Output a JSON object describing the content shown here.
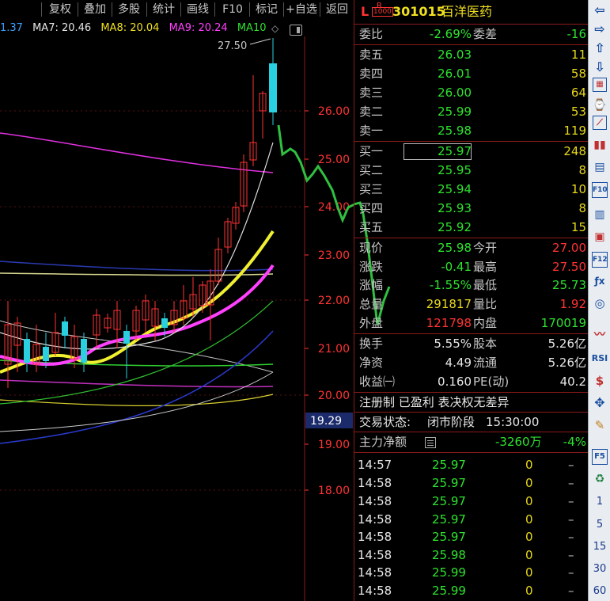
{
  "toolbar": {
    "items": [
      "复权",
      "叠加",
      "多股",
      "统计",
      "画线",
      "F10",
      "标记",
      "+自选",
      "返回"
    ]
  },
  "ma_bar": [
    {
      "label": "1.37",
      "color": "#3aa0ff"
    },
    {
      "label": "MA7: 20.46",
      "color": "#e6e6e6"
    },
    {
      "label": "MA8: 20.04",
      "color": "#f0e020"
    },
    {
      "label": "MA9: 20.24",
      "color": "#ff40ff"
    },
    {
      "label": "MA10",
      "color": "#30e030"
    }
  ],
  "chart": {
    "high_label": "27.50",
    "price_ticks": [
      "26.00",
      "25.00",
      "24.00",
      "23.00",
      "22.00",
      "21.00",
      "20.00",
      "19.00",
      "18.00"
    ],
    "current_marker": "19.29"
  },
  "stock": {
    "flag_L": "L",
    "flag_R": "R",
    "flag_num": "1000",
    "code": "301015",
    "name": "百洋医药"
  },
  "weibi": {
    "label": "委比",
    "value": "-2.69%",
    "label2": "委差",
    "value2": "-16"
  },
  "asks": [
    {
      "label": "卖五",
      "price": "26.03",
      "vol": "11"
    },
    {
      "label": "卖四",
      "price": "26.01",
      "vol": "58"
    },
    {
      "label": "卖三",
      "price": "26.00",
      "vol": "64"
    },
    {
      "label": "卖二",
      "price": "25.99",
      "vol": "53"
    },
    {
      "label": "卖一",
      "price": "25.98",
      "vol": "119"
    }
  ],
  "bids": [
    {
      "label": "买一",
      "price": "25.97",
      "vol": "248"
    },
    {
      "label": "买二",
      "price": "25.95",
      "vol": "8"
    },
    {
      "label": "买三",
      "price": "25.94",
      "vol": "10"
    },
    {
      "label": "买四",
      "price": "25.93",
      "vol": "8"
    },
    {
      "label": "买五",
      "price": "25.92",
      "vol": "15"
    }
  ],
  "quote": [
    {
      "l1": "现价",
      "v1": "25.98",
      "c1": "green",
      "l2": "今开",
      "v2": "27.00",
      "c2": "red"
    },
    {
      "l1": "涨跌",
      "v1": "-0.41",
      "c1": "green",
      "l2": "最高",
      "v2": "27.50",
      "c2": "red"
    },
    {
      "l1": "涨幅",
      "v1": "-1.55%",
      "c1": "green",
      "l2": "最低",
      "v2": "25.73",
      "c2": "green"
    },
    {
      "l1": "总量",
      "v1": "291817",
      "c1": "yellow",
      "l2": "量比",
      "v2": "1.92",
      "c2": "red"
    },
    {
      "l1": "外盘",
      "v1": "121798",
      "c1": "red",
      "l2": "内盘",
      "v2": "170019",
      "c2": "green"
    }
  ],
  "fund": [
    {
      "l1": "换手",
      "v1": "5.55%",
      "l2": "股本",
      "v2": "5.26亿"
    },
    {
      "l1": "净资",
      "v1": "4.49",
      "l2": "流通",
      "v2": "5.26亿"
    },
    {
      "l1": "收益㈠",
      "v1": "0.160",
      "l2": "PE(动)",
      "v2": "40.2"
    }
  ],
  "tags": "注册制 已盈利 表决权无差异",
  "trade_status": {
    "label": "交易状态:",
    "status": "闭市阶段",
    "time": "15:30:00"
  },
  "main_flow": {
    "label": "主力净额",
    "value": "-3260万",
    "pct": "-4%"
  },
  "ticks": [
    {
      "time": "14:57",
      "price": "25.97",
      "vol": "0",
      "dir": "–"
    },
    {
      "time": "14:58",
      "price": "25.97",
      "vol": "0",
      "dir": "–"
    },
    {
      "time": "14:58",
      "price": "25.97",
      "vol": "0",
      "dir": "–"
    },
    {
      "time": "14:58",
      "price": "25.97",
      "vol": "0",
      "dir": "–"
    },
    {
      "time": "14:58",
      "price": "25.97",
      "vol": "0",
      "dir": "–"
    },
    {
      "time": "14:58",
      "price": "25.98",
      "vol": "0",
      "dir": "–"
    },
    {
      "time": "14:58",
      "price": "25.99",
      "vol": "0",
      "dir": "–"
    },
    {
      "time": "14:58",
      "price": "25.99",
      "vol": "0",
      "dir": "–"
    }
  ],
  "sidebar_icons": [
    "arrow-left-icon",
    "arrow-right-icon",
    "arrow-up-icon",
    "arrow-down-icon",
    "grid-icon",
    "time-share-icon",
    "trend-line-icon",
    "candlestick-icon",
    "notes-icon",
    "f10-icon",
    "list-doc-icon",
    "bookmark-icon",
    "f12-icon",
    "fx-icon",
    "refresh-icon",
    "wave-icon",
    "rsi-icon",
    "dollar-icon",
    "move-icon",
    "pencil-icon",
    "f5-icon",
    "recycle-icon"
  ],
  "sidebar_labels": {
    "rsi": "RSI",
    "f5": "F5",
    "f10": "F10",
    "f12": "F12"
  },
  "periods": [
    "1",
    "5",
    "15",
    "30",
    "60"
  ]
}
